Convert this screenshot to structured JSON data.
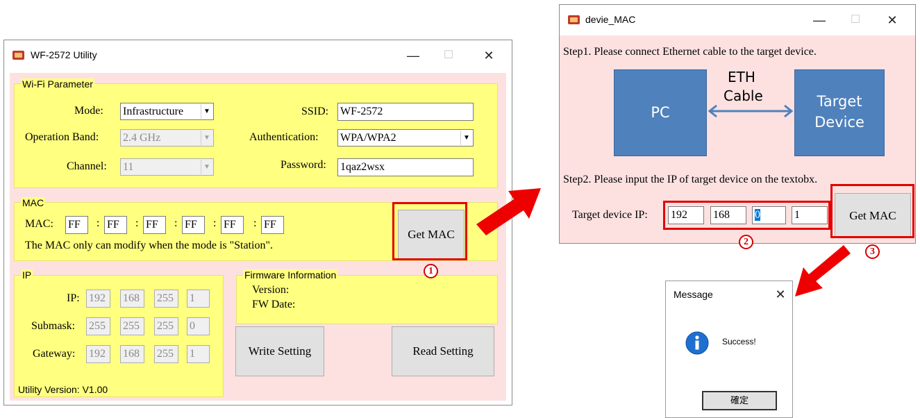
{
  "main_window": {
    "title": "WF-2572 Utility",
    "minimize_glyph": "—",
    "maximize_glyph": "☐",
    "close_glyph": "✕",
    "wifi": {
      "group_title": "Wi-Fi Parameter",
      "mode_label": "Mode:",
      "mode_value": "Infrastructure",
      "band_label": "Operation Band:",
      "band_value": "2.4 GHz",
      "channel_label": "Channel:",
      "channel_value": "11",
      "ssid_label": "SSID:",
      "ssid_value": "WF-2572",
      "auth_label": "Authentication:",
      "auth_value": "WPA/WPA2",
      "password_label": "Password:",
      "password_value": "1qaz2wsx"
    },
    "mac": {
      "group_title": "MAC",
      "label": "MAC:",
      "octets": [
        "FF",
        "FF",
        "FF",
        "FF",
        "FF",
        "FF"
      ],
      "separator": ":",
      "note": "The MAC only can modify when the mode is \"Station\".",
      "get_mac_button": "Get MAC"
    },
    "ip": {
      "group_title": "IP",
      "ip_label": "IP:",
      "ip_values": [
        "192",
        "168",
        "255",
        "1"
      ],
      "submask_label": "Submask:",
      "submask_values": [
        "255",
        "255",
        "255",
        "0"
      ],
      "gateway_label": "Gateway:",
      "gateway_values": [
        "192",
        "168",
        "255",
        "1"
      ]
    },
    "firmware": {
      "group_title": "Firmware Information",
      "version_label": "Version:",
      "fw_date_label": "FW Date:"
    },
    "write_button": "Write Setting",
    "read_button": "Read Setting",
    "utility_version": "Utility Version: V1.00"
  },
  "device_mac_window": {
    "title": "devie_MAC",
    "minimize_glyph": "—",
    "maximize_glyph": "☐",
    "close_glyph": "✕",
    "step1": "Step1. Please connect Ethernet cable to the target device.",
    "diagram": {
      "pc_label": "PC",
      "cable_label_1": "ETH",
      "cable_label_2": "Cable",
      "target_label_1": "Target",
      "target_label_2": "Device"
    },
    "step2": "Step2. Please input the IP of target device on the textobx.",
    "target_ip_label": "Target device IP:",
    "target_ip_values": [
      "192",
      "168",
      "0",
      "1"
    ],
    "get_mac_button": "Get MAC"
  },
  "message_box": {
    "title": "Message",
    "close_glyph": "✕",
    "text": "Success!",
    "ok_button": "確定"
  },
  "annotations": {
    "step_1": "1",
    "step_2": "2",
    "step_3": "3"
  },
  "colors": {
    "client_background": "#fde1e1",
    "group_background": "#ffff80",
    "highlight_red": "#e30000",
    "diagram_blue": "#4f81bd"
  }
}
